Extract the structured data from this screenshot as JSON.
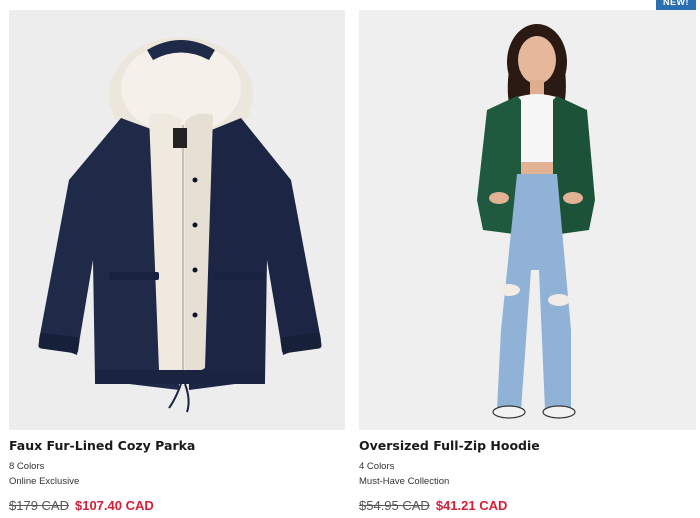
{
  "products": [
    {
      "badge": "",
      "name": "Faux Fur-Lined Cozy Parka",
      "colors": "8 Colors",
      "tagline": "Online Exclusive",
      "price_original": "$179 CAD",
      "price_sale": "$107.40 CAD",
      "image_icon": "parka-jacket-image"
    },
    {
      "badge": "NEW!",
      "name": "Oversized Full-Zip Hoodie",
      "colors": "4 Colors",
      "tagline": "Must-Have Collection",
      "price_original": "$54.95 CAD",
      "price_sale": "$41.21 CAD",
      "image_icon": "model-in-green-hoodie-image"
    }
  ],
  "colors": {
    "sale_price": "#d21f35",
    "badge_bg": "#2a6fb0",
    "parka_navy": "#1f2a48",
    "hoodie_green": "#1f5a3e",
    "denim": "#8fb2d6"
  }
}
